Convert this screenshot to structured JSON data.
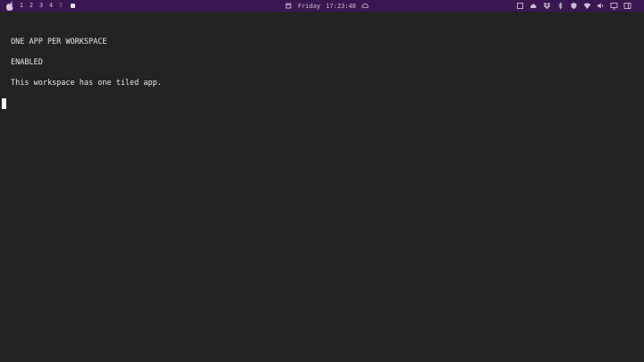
{
  "menubar": {
    "workspaces": [
      "1",
      "2",
      "3",
      "4",
      "5"
    ],
    "day": "Friday",
    "time": "17:23:48",
    "colors": {
      "bar": "#3a1750",
      "text": "#c9bdd4"
    },
    "right_icons": [
      "window-icon",
      "cloud-upload-icon",
      "dropbox-icon",
      "bluetooth-icon",
      "vpn-icon",
      "wifi-icon",
      "volume-icon",
      "display-icon",
      "notification-icon"
    ]
  },
  "terminal": {
    "lines": [
      "ONE APP PER WORKSPACE",
      "ENABLED",
      "This workspace has one tiled app."
    ],
    "colors": {
      "background": "#232323",
      "text": "#e6e6e6"
    }
  }
}
